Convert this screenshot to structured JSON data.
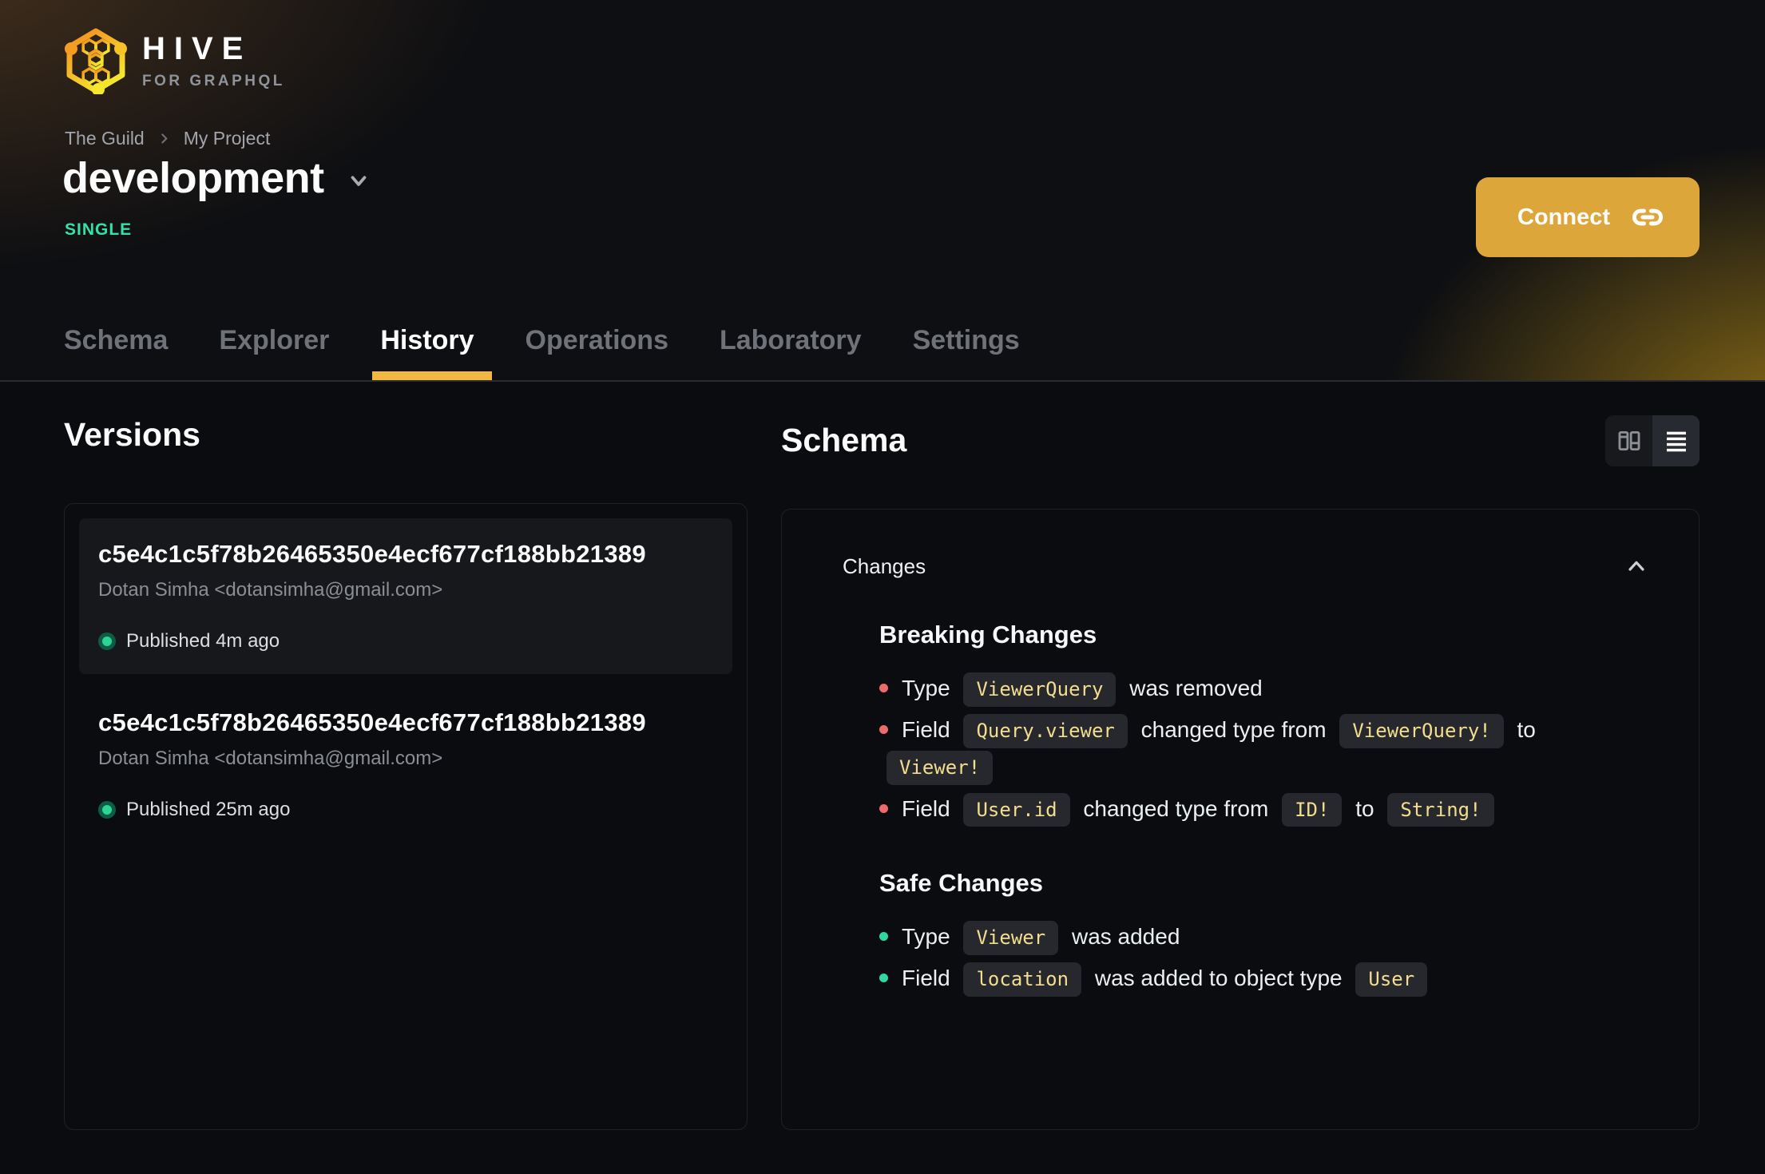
{
  "brand": {
    "name": "HIVE",
    "tagline": "FOR GRAPHQL"
  },
  "breadcrumb": {
    "items": [
      "The Guild",
      "My Project"
    ]
  },
  "header": {
    "target_name": "development",
    "mode_badge": "SINGLE",
    "connect_label": "Connect"
  },
  "tabs": {
    "items": [
      {
        "label": "Schema"
      },
      {
        "label": "Explorer"
      },
      {
        "label": "History",
        "active": true
      },
      {
        "label": "Operations"
      },
      {
        "label": "Laboratory"
      },
      {
        "label": "Settings"
      }
    ]
  },
  "versions": {
    "title": "Versions",
    "items": [
      {
        "hash": "c5e4c1c5f78b26465350e4ecf677cf188bb21389",
        "author": "Dotan Simha <dotansimha@gmail.com>",
        "status": "Published 4m ago",
        "highlighted": true
      },
      {
        "hash": "c5e4c1c5f78b26465350e4ecf677cf188bb21389",
        "author": "Dotan Simha <dotansimha@gmail.com>",
        "status": "Published 25m ago"
      }
    ]
  },
  "schema": {
    "title": "Schema",
    "panel_title": "Changes"
  },
  "changes": {
    "sections": [
      {
        "title": "Breaking Changes",
        "kind": "breaking",
        "items": [
          [
            {
              "t": "text",
              "v": "Type "
            },
            {
              "t": "code",
              "v": "ViewerQuery"
            },
            {
              "t": "text",
              "v": " was removed"
            }
          ],
          [
            {
              "t": "text",
              "v": "Field "
            },
            {
              "t": "code",
              "v": "Query.viewer"
            },
            {
              "t": "text",
              "v": " changed type from "
            },
            {
              "t": "code",
              "v": "ViewerQuery!"
            },
            {
              "t": "text",
              "v": " to "
            },
            {
              "t": "code",
              "v": "Viewer!"
            }
          ],
          [
            {
              "t": "text",
              "v": "Field "
            },
            {
              "t": "code",
              "v": "User.id"
            },
            {
              "t": "text",
              "v": " changed type from "
            },
            {
              "t": "code",
              "v": "ID!"
            },
            {
              "t": "text",
              "v": " to "
            },
            {
              "t": "code",
              "v": "String!"
            }
          ]
        ]
      },
      {
        "title": "Safe Changes",
        "kind": "safe",
        "items": [
          [
            {
              "t": "text",
              "v": "Type "
            },
            {
              "t": "code",
              "v": "Viewer"
            },
            {
              "t": "text",
              "v": " was added"
            }
          ],
          [
            {
              "t": "text",
              "v": "Field "
            },
            {
              "t": "code",
              "v": "location"
            },
            {
              "t": "text",
              "v": " was added to object type "
            },
            {
              "t": "code",
              "v": "User"
            }
          ]
        ]
      }
    ]
  },
  "colors": {
    "accent_amber": "#dda63a",
    "tab_underline": "#f2b643",
    "badge_green": "#35e2a5",
    "status_dot_green": "#2bd596",
    "breaking_bullet_red": "#ed6b6b",
    "safe_bullet_green": "#2fd89f",
    "code_chip_text": "#f3dd8e",
    "code_chip_bg": "#26282d"
  }
}
